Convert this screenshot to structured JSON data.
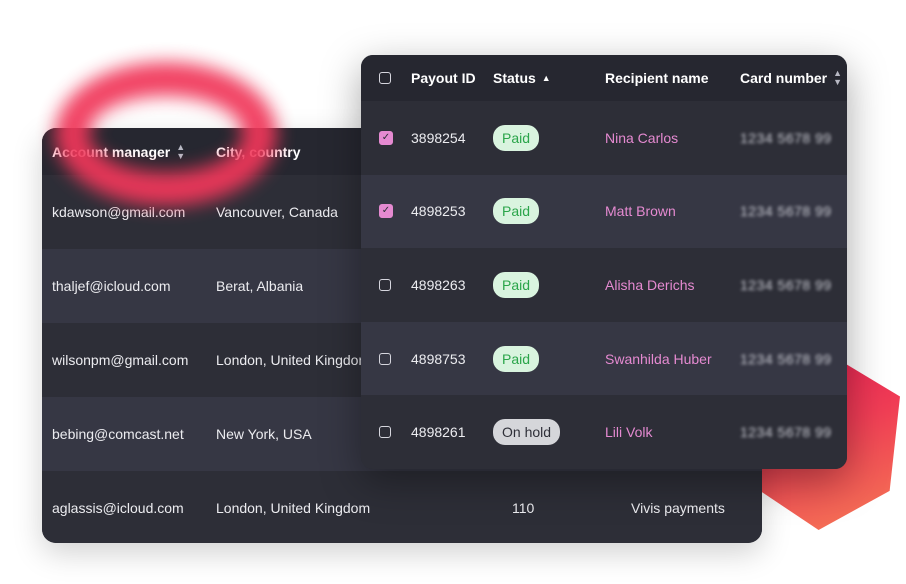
{
  "back_table": {
    "headers": {
      "account_manager": "Account manager",
      "city_country": "City, country"
    },
    "rows": [
      {
        "email": "kdawson@gmail.com",
        "city": "Vancouver, Canada",
        "number": "",
        "type": ""
      },
      {
        "email": "thaljef@icloud.com",
        "city": "Berat, Albania",
        "number": "",
        "type": ""
      },
      {
        "email": "wilsonpm@gmail.com",
        "city": "London, United Kingdom",
        "number": "",
        "type": ""
      },
      {
        "email": "bebing@comcast.net",
        "city": "New York, USA",
        "number": "",
        "type": ""
      },
      {
        "email": "aglassis@icloud.com",
        "city": "London, United Kingdom",
        "number": "110",
        "type": "Vivis payments"
      }
    ]
  },
  "front_table": {
    "headers": {
      "payout_id": "Payout ID",
      "status": "Status",
      "recipient_name": "Recipient name",
      "card_number": "Card number"
    },
    "rows": [
      {
        "checked": true,
        "id": "3898254",
        "status": "Paid",
        "recipient": "Nina Carlos",
        "card": "1234 5678 99"
      },
      {
        "checked": true,
        "id": "4898253",
        "status": "Paid",
        "recipient": "Matt Brown",
        "card": "1234 5678 99"
      },
      {
        "checked": false,
        "id": "4898263",
        "status": "Paid",
        "recipient": "Alisha Derichs",
        "card": "1234 5678 99"
      },
      {
        "checked": false,
        "id": "4898753",
        "status": "Paid",
        "recipient": "Swanhilda Huber",
        "card": "1234 5678 99"
      },
      {
        "checked": false,
        "id": "4898261",
        "status": "On hold",
        "recipient": "Lili Volk",
        "card": "1234 5678 99"
      }
    ]
  },
  "colors": {
    "panel": "#2e2f38",
    "row_alt": "#363744",
    "accent_pink": "#e58ad1",
    "paid_bg": "#d9f4df",
    "paid_text": "#2aa54a",
    "hold_bg": "#d5d6da"
  },
  "icons": {
    "sort": "sort-icon",
    "sort_asc": "sort-ascending-icon",
    "check": "check-icon"
  }
}
